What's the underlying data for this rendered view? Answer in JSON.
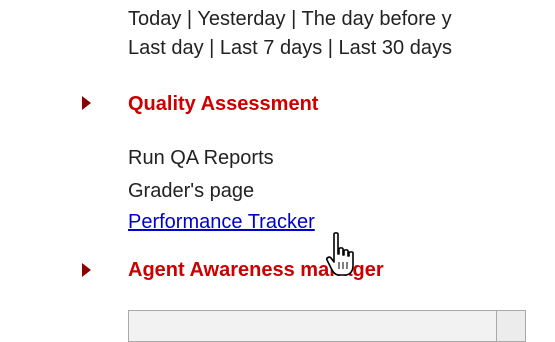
{
  "reports_period": {
    "row1": [
      "Today",
      "Yesterday",
      "The day before y"
    ],
    "row2": [
      "Last day",
      "Last 7 days",
      "Last 30 days"
    ],
    "separator": " | "
  },
  "quality_assessment": {
    "title": "Quality Assessment",
    "items": [
      "Run QA Reports",
      "Grader's page"
    ],
    "link": "Performance Tracker"
  },
  "agent_awareness": {
    "title": "Agent Awareness manager"
  },
  "icons": {
    "bullet": "triangle-right-icon",
    "cursor": "hand-pointer-icon"
  },
  "colors": {
    "section_title": "#cc0000",
    "bullet": "#8b0000",
    "link": "#0000cc",
    "text": "#222222"
  }
}
